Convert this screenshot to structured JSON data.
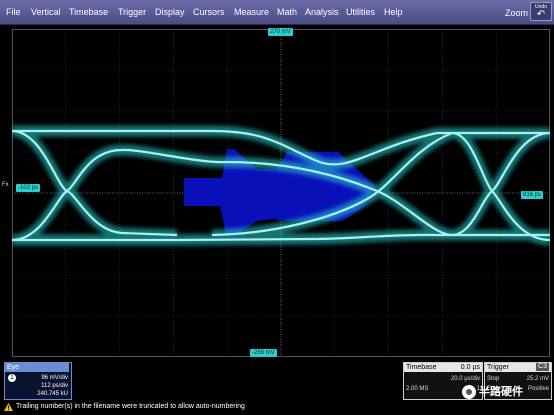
{
  "menubar": {
    "items": [
      "File",
      "Vertical",
      "Timebase",
      "Trigger",
      "Display",
      "Cursors",
      "Measure",
      "Math",
      "Analysis",
      "Utilities",
      "Help"
    ],
    "zoom_label": "Zoom",
    "undo_label": "Undo",
    "undo_icon": "undo-arrow-icon"
  },
  "display": {
    "top_marker": "270 mV",
    "bottom_marker": "-268 mV",
    "left_marker": "-102 ps",
    "right_marker": "916 ps",
    "fx_label": "Fx",
    "trace_color": "#2ad0d0",
    "mask_color": "#0a10b8"
  },
  "eye_panel": {
    "title": "Eye",
    "number": "1",
    "rows": [
      "96 mV/div",
      "112 ps/div",
      "240.745 kU"
    ]
  },
  "timebase_panel": {
    "title": "Timebase",
    "value": "0.0 µs",
    "rows_left": [
      "",
      "2.00 MS"
    ],
    "rows_right": [
      "20.0 µs/div",
      "1"
    ]
  },
  "trigger_panel": {
    "title": "Trigger",
    "badge": "C3",
    "rows_left": [
      "Stop",
      "Edge"
    ],
    "rows_right": [
      "25.2 mV",
      "Positive"
    ]
  },
  "status": {
    "message": "Trailing number(s) in the filename were truncated to allow auto-numbering",
    "icon": "warning-icon"
  },
  "watermark": "半路硬件"
}
